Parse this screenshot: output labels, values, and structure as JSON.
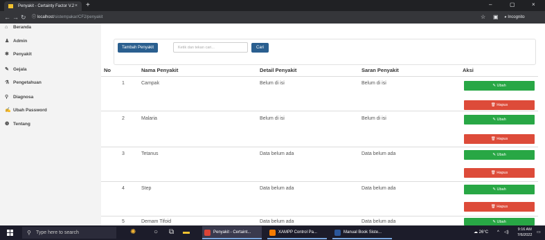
{
  "browser": {
    "tab_title": "Penyakit - Certainty Factor V.2",
    "tab_close": "×",
    "new_tab": "+",
    "min": "–",
    "max": "▢",
    "close": "×",
    "url_host": "localhost",
    "url_path": "/sistempakar/CF2/penyakit",
    "incognito_label": "Incognito",
    "star": "☆"
  },
  "sidebar": {
    "items": [
      {
        "icon": "home-icon",
        "glyph": "⌂",
        "label": "Beranda"
      },
      {
        "icon": "user-icon",
        "glyph": "♟",
        "label": "Admin"
      },
      {
        "icon": "bug-icon",
        "glyph": "✱",
        "label": "Penyakit"
      },
      {
        "icon": "pencil-icon",
        "glyph": "✎",
        "label": "Gejala"
      },
      {
        "icon": "flask-icon",
        "glyph": "⚗",
        "label": "Pengetahuan"
      },
      {
        "icon": "diagnosis-icon",
        "glyph": "⚲",
        "label": "Diagnosa"
      },
      {
        "icon": "edit-icon",
        "glyph": "✍",
        "label": "Ubah Password"
      },
      {
        "icon": "info-icon",
        "glyph": "❶",
        "label": "Tentang"
      }
    ]
  },
  "toolbar": {
    "add_label": "Tambah Penyakit",
    "search_placeholder": "Ketik dan tekan cari...",
    "search_label": "Cari"
  },
  "table": {
    "headers": [
      "No",
      "Nama Penyakit",
      "Detail Penyakit",
      "Saran Penyakit",
      "Aksi"
    ],
    "rows": [
      {
        "no": "1",
        "nama": "Campak",
        "detail": "Belum di isi",
        "saran": "Belum di isi"
      },
      {
        "no": "2",
        "nama": "Malaria",
        "detail": "Belum di isi",
        "saran": "Belum di isi"
      },
      {
        "no": "3",
        "nama": "Tetanus",
        "detail": "Data belum ada",
        "saran": "Data belum ada"
      },
      {
        "no": "4",
        "nama": "Step",
        "detail": "Data belum ada",
        "saran": "Data belum ada"
      },
      {
        "no": "5",
        "nama": "Demam Tifoid",
        "detail": "Data belum ada",
        "saran": "Data belum ada"
      }
    ],
    "edit_label": "✎ Ubah",
    "delete_label": "🗑 Hapus"
  },
  "taskbar": {
    "search_placeholder": "Type here to search",
    "apps": [
      "Penyakit - Certaint...",
      "XAMPP Control Pa...",
      "Manual Book Siste..."
    ],
    "weather": "26°C",
    "time": "9:16 AM",
    "date": "7/6/2022"
  },
  "colors": {
    "primary": "#2a5f8f",
    "success": "#28a745",
    "danger": "#dd4b39"
  }
}
